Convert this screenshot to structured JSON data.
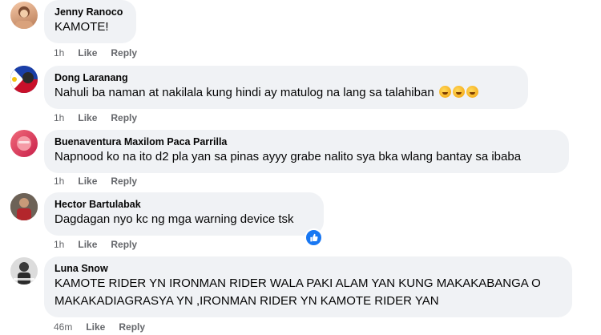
{
  "comments": [
    {
      "name": "Jenny Ranoco",
      "text": "KAMOTE!",
      "time": "1h",
      "like": "Like",
      "reply": "Reply"
    },
    {
      "name": "Dong Laranang",
      "text": "Nahuli ba naman at nakilala kung hindi ay matulog na lang sa talahiban",
      "emoji_count": 3,
      "emoji": "rolling-on-floor-laughing-icon",
      "time": "1h",
      "like": "Like",
      "reply": "Reply"
    },
    {
      "name": "Buenaventura Maxilom Paca Parrilla",
      "text": "Napnood ko na ito d2 pla yan sa pinas ayyy grabe nalito sya bka wlang bantay sa ibaba",
      "time": "1h",
      "like": "Like",
      "reply": "Reply"
    },
    {
      "name": "Hector Bartulabak",
      "text": "Dagdagan nyo kc ng mga warning device tsk",
      "time": "1h",
      "like": "Like",
      "reply": "Reply",
      "reaction": "like-reaction-icon"
    },
    {
      "name": "Luna Snow",
      "text": "KAMOTE RIDER YN IRONMAN RIDER WALA PAKI ALAM YAN KUNG MAKAKABANGA O\nMAKAKADIAGRASYA YN ,IRONMAN RIDER YN KAMOTE RIDER YAN",
      "time": "46m",
      "like": "Like",
      "reply": "Reply"
    }
  ],
  "colors": {
    "bubble": "#f0f2f5",
    "meta": "#65676b",
    "like_blue": "#1877f2"
  }
}
